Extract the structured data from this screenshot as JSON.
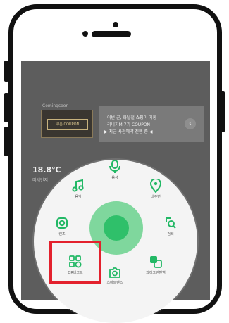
{
  "banner": {
    "kicker": "Comingsoon",
    "coupon_text": "쿠폰 COUPON",
    "line1": "이번 곧, 화날철 쇼핑이 기동",
    "line2": "리니지M 7기 COUPON",
    "line3": "▶ 지금 사전예약 진행 중 ◀",
    "arrow": "‹"
  },
  "stat": {
    "value": "18.8℃",
    "sub": "미세먼지"
  },
  "dial": {
    "items": [
      {
        "label": "음성",
        "icon": "microphone-icon"
      },
      {
        "label": "음악",
        "icon": "music-note-icon"
      },
      {
        "label": "내주변",
        "icon": "location-pin-icon"
      },
      {
        "label": "렌즈",
        "icon": "lens-icon"
      },
      {
        "label": "검색",
        "icon": "search-icon"
      },
      {
        "label": "QR바코드",
        "icon": "qr-barcode-icon"
      },
      {
        "label": "스마트렌즈",
        "icon": "camera-icon"
      },
      {
        "label": "와이그린번역",
        "icon": "translate-icon"
      }
    ]
  },
  "colors": {
    "accent": "#2fc06a",
    "highlight": "#e3212d"
  }
}
